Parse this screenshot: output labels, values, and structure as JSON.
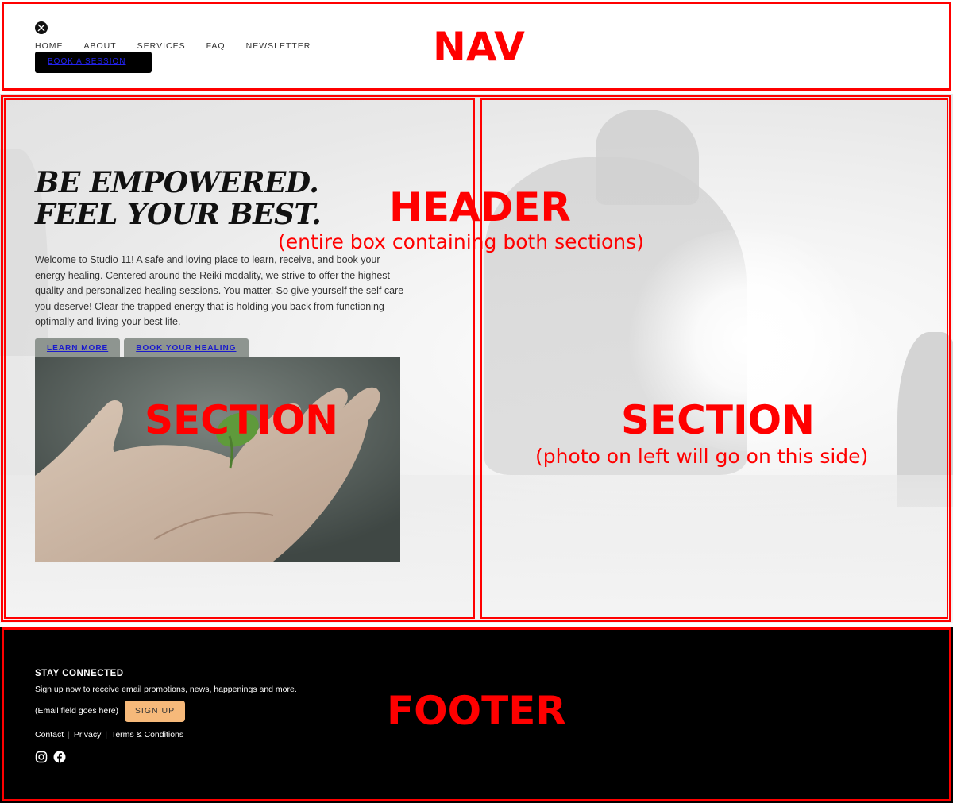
{
  "nav": {
    "links": [
      "HOME",
      "ABOUT",
      "SERVICES",
      "FAQ",
      "NEWSLETTER"
    ],
    "book_label": "BOOK A SESSION"
  },
  "header": {
    "headline_1": "BE EMPOWERED.",
    "headline_2": "FEEL YOUR BEST.",
    "intro": "Welcome to Studio 11! A safe and loving place to learn, receive, and book your energy healing. Centered around the Reiki modality, we strive to offer the highest quality and personalized healing sessions. You matter. So give yourself the self care you deserve! Clear the trapped energy that is holding you back from functioning optimally and living your best life.",
    "learn_more": "LEARN MORE",
    "book_healing": "BOOK YOUR HEALING"
  },
  "footer": {
    "title": "STAY CONNECTED",
    "desc": "Sign up now to receive email promotions, news, happenings and more.",
    "email_placeholder": "(Email field goes here)",
    "signup": "SIGN UP",
    "links": [
      "Contact",
      "Privacy",
      "Terms & Conditions"
    ],
    "social_icons": [
      "instagram-icon",
      "facebook-icon"
    ],
    "signup_color": "#f6b97a"
  },
  "annotations": {
    "nav": "NAV",
    "header": "HEADER",
    "header_sub": "(entire box containing both sections)",
    "section_left": "SECTION",
    "section_right": "SECTION",
    "section_right_sub": "(photo on left will go on this side)",
    "footer": "FOOTER",
    "color": "#ff0000"
  }
}
